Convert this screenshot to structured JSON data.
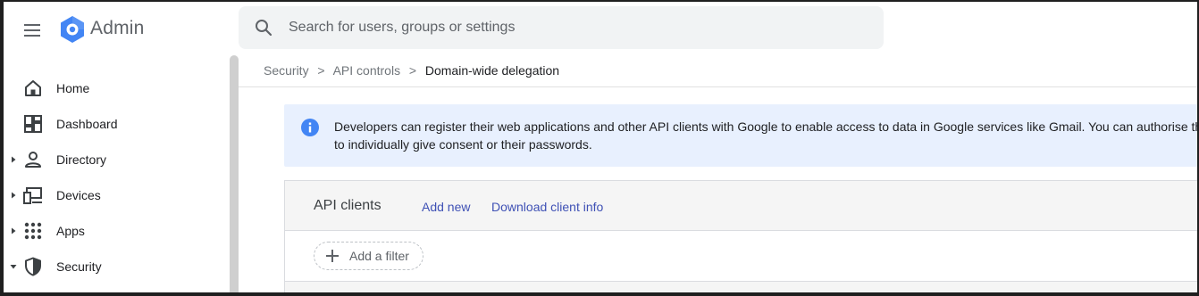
{
  "app": {
    "title": "Admin",
    "brand_color": "#4285f4"
  },
  "search": {
    "placeholder": "Search for users, groups or settings",
    "value": ""
  },
  "sidebar": {
    "items": [
      {
        "label": "Home",
        "icon": "home-icon",
        "expander": "none"
      },
      {
        "label": "Dashboard",
        "icon": "dashboard-icon",
        "expander": "none"
      },
      {
        "label": "Directory",
        "icon": "person-icon",
        "expander": "collapsed"
      },
      {
        "label": "Devices",
        "icon": "devices-icon",
        "expander": "collapsed"
      },
      {
        "label": "Apps",
        "icon": "apps-grid-icon",
        "expander": "collapsed"
      },
      {
        "label": "Security",
        "icon": "shield-icon",
        "expander": "expanded"
      }
    ]
  },
  "breadcrumb": {
    "items": [
      "Security",
      "API controls"
    ],
    "separator": ">",
    "current": "Domain-wide delegation"
  },
  "info_banner": {
    "icon": "info-icon",
    "line1": "Developers can register their web applications and other API clients with Google to enable access to data in Google services like Gmail. You can authorise th",
    "line2": "to individually give consent or their passwords."
  },
  "api_clients": {
    "title": "API clients",
    "add_new_label": "Add new",
    "download_label": "Download client info",
    "filter_label": "Add a filter",
    "link_color": "#3f51b5"
  }
}
